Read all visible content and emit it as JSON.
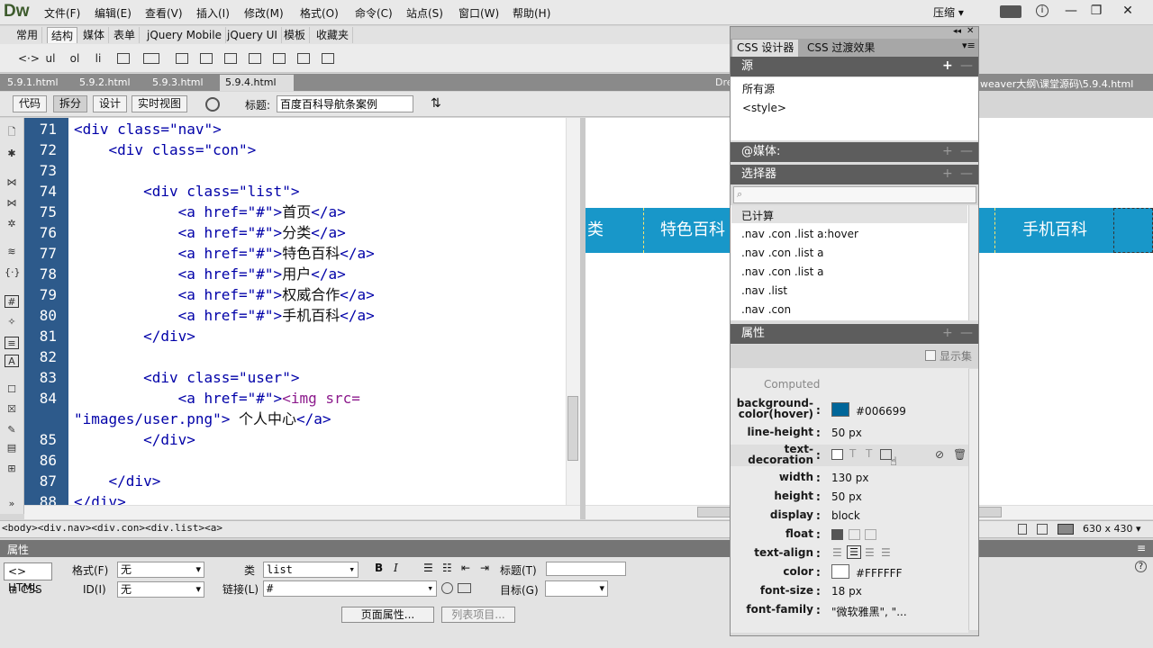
{
  "app": {
    "logo": "Dw",
    "layout_label": "压缩 ▾",
    "menu": [
      "文件(F)",
      "编辑(E)",
      "查看(V)",
      "插入(I)",
      "修改(M)",
      "格式(O)",
      "命令(C)",
      "站点(S)",
      "窗口(W)",
      "帮助(H)"
    ]
  },
  "insert_bar": {
    "tabs": [
      "常用",
      "结构",
      "媒体",
      "表单",
      "jQuery Mobile",
      "jQuery UI",
      "模板",
      "收藏夹"
    ],
    "active_tab": "结构",
    "icons": [
      "<·>",
      "ul",
      "ol",
      "li"
    ]
  },
  "doc_tabs": {
    "tabs": [
      "5.9.1.html",
      "5.9.2.html",
      "5.9.3.html",
      "5.9.4.html"
    ],
    "active": "5.9.4.html",
    "path_left": "Dreamw",
    "path_right": "weaver大纲\\课堂源码\\5.9.4.html"
  },
  "doc_toolbar": {
    "views": [
      "代码",
      "拆分",
      "设计",
      "实时视图"
    ],
    "active_view": "拆分",
    "title_label": "标题:",
    "title_value": "百度百科导航条案例"
  },
  "code": {
    "line_numbers": [
      "71",
      "72",
      "73",
      "74",
      "75",
      "76",
      "77",
      "78",
      "79",
      "80",
      "81",
      "82",
      "83",
      "84",
      "",
      "85",
      "86",
      "87",
      "88"
    ],
    "nav_open": "<div class=\"nav\">",
    "con_open": "<div class=\"con\">",
    "list_open": "<div class=\"list\">",
    "a_open": "<a href=\"#\">",
    "a_close": "</a>",
    "div_close": "</div>",
    "user_open": "<div class=\"user\">",
    "img_tag": "<img src=",
    "img_src": "\"images/user.png\">",
    "link_texts": [
      "首页",
      "分类",
      "特色百科",
      "用户",
      "权威合作",
      "手机百科"
    ],
    "user_text": " 个人中心"
  },
  "live_view": {
    "nav_items": [
      "类",
      "特色百科",
      "手机百科"
    ],
    "nav_color": "#1897c9"
  },
  "status_bar": {
    "tags": "<body><div.nav><div.con><div.list><a>",
    "window_size": "630 x 430 ▾"
  },
  "property_inspector": {
    "title": "属性",
    "html_label": "<> HTML",
    "css_label": "CSS",
    "format_label": "格式(F)",
    "format_value": "无",
    "class_label": "类",
    "class_value": "list",
    "id_label": "ID(I)",
    "id_value": "无",
    "link_label": "链接(L)",
    "link_value": "#",
    "title_label": "标题(T)",
    "target_label": "目标(G)",
    "bold": "B",
    "italic": "I",
    "page_props": "页面属性...",
    "list_item": "列表项目..."
  },
  "css_designer": {
    "tabs": [
      "CSS 设计器",
      "CSS 过渡效果"
    ],
    "sources_header": "源",
    "sources": [
      "所有源",
      "<style>"
    ],
    "media_header": "@媒体:",
    "selectors_header": "选择器",
    "selectors": [
      "已计算",
      ".nav .con .list a:hover",
      ".nav .con .list a",
      ".nav .con .list a",
      ".nav .list",
      ".nav .con"
    ],
    "properties_header": "属性",
    "show_set": "显示集",
    "computed_label": "Computed",
    "properties": {
      "bg_name": "background-color(hover)",
      "bg_name_1": "background-",
      "bg_name_2": "color(hover)",
      "bg_value": "#006699",
      "line_height_name": "line-height",
      "line_height_value": "50 px",
      "text_dec_name_1": "text-",
      "text_dec_name_2": "decoration",
      "width_name": "width",
      "width_value": "130 px",
      "height_name": "height",
      "height_value": "50 px",
      "display_name": "display",
      "display_value": "block",
      "float_name": "float",
      "text_align_name": "text-align",
      "color_name": "color",
      "color_value": "#FFFFFF",
      "font_size_name": "font-size",
      "font_size_value": "18 px",
      "font_family_name": "font-family",
      "font_family_value": "\"微软雅黑\", \"..."
    }
  }
}
